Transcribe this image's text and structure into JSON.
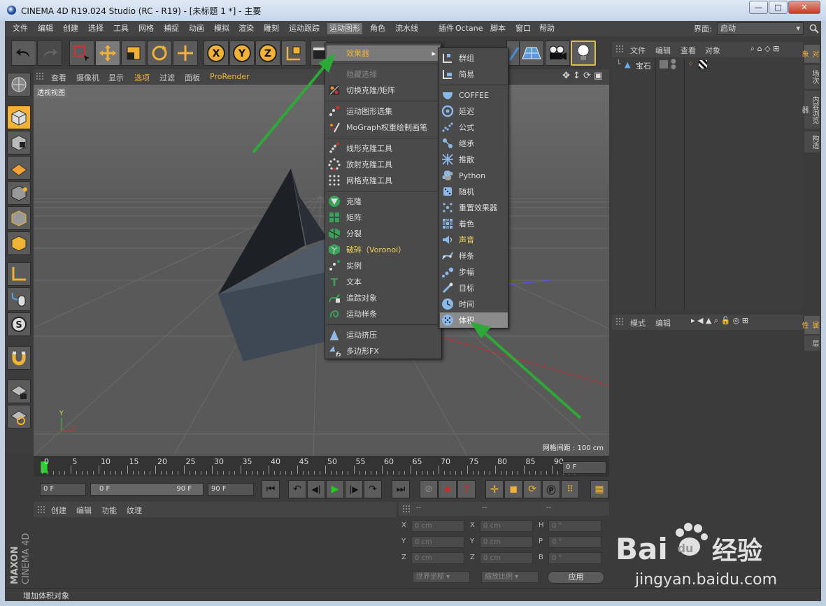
{
  "window": {
    "title": "CINEMA 4D R19.024 Studio (RC - R19) - [未标题 1 *] - 主要",
    "minimize": "—",
    "maximize": "□",
    "close": "✕"
  },
  "menubar": {
    "items": [
      "文件",
      "编辑",
      "创建",
      "选择",
      "工具",
      "网格",
      "捕捉",
      "动画",
      "模拟",
      "渲染",
      "雕刻",
      "运动跟踪",
      "运动图形",
      "角色",
      "流水线",
      "插件",
      "Octane",
      "脚本",
      "窗口",
      "帮助"
    ],
    "active": "运动图形",
    "layout_label": "界面:",
    "layout_value": "启动"
  },
  "viewport": {
    "menu": [
      "查看",
      "摄像机",
      "显示",
      "选项",
      "过滤",
      "面板",
      "ProRender"
    ],
    "label": "透视视图",
    "grid_spacing": "网格间距 : 100 cm"
  },
  "timeline": {
    "ticks": [
      "0",
      "5",
      "10",
      "15",
      "20",
      "25",
      "30",
      "35",
      "40",
      "45",
      "50",
      "55",
      "60",
      "65",
      "70",
      "75",
      "80",
      "85",
      "90"
    ],
    "current_frame": "0 F"
  },
  "playback": {
    "start": "0 F",
    "range_start": "0 F",
    "range_end": "90 F",
    "end": "90 F"
  },
  "material": {
    "menu": [
      "创建",
      "编辑",
      "功能",
      "纹理"
    ]
  },
  "coords": {
    "header": [
      "--",
      "--",
      "--"
    ],
    "rows": [
      {
        "a": "X",
        "av": "0 cm",
        "b": "X",
        "bv": "0 cm",
        "c": "H",
        "cv": "0 °"
      },
      {
        "a": "Y",
        "av": "0 cm",
        "b": "Y",
        "bv": "0 cm",
        "c": "P",
        "cv": "0 °"
      },
      {
        "a": "Z",
        "av": "0 cm",
        "b": "Z",
        "bv": "0 cm",
        "c": "B",
        "cv": "0 °"
      }
    ],
    "world": "世界坐标",
    "scale": "缩放比例",
    "apply": "应用"
  },
  "status": "增加体积对象",
  "objects_panel": {
    "menu": [
      "文件",
      "编辑",
      "查看",
      "对象"
    ],
    "object_name": "宝石"
  },
  "attributes_panel": {
    "menu": [
      "模式",
      "编辑"
    ]
  },
  "right_tabs": [
    "对象",
    "场次",
    "内容浏览器",
    "构造",
    "属性",
    "层"
  ],
  "main_menu": {
    "items": [
      {
        "label": "效果器",
        "icon": "none-icon",
        "state": "highlight",
        "submenu": true
      },
      {
        "sep": true
      },
      {
        "label": "隐藏选择",
        "icon": "none-icon",
        "state": "disabled"
      },
      {
        "label": "切换克隆/矩阵",
        "icon": "toggle-clone-icon",
        "state": "normal"
      },
      {
        "sep": true
      },
      {
        "label": "运动图形选集",
        "icon": "mograph-selection-icon",
        "state": "normal"
      },
      {
        "label": "MoGraph权重绘制画笔",
        "icon": "weight-brush-icon",
        "state": "normal"
      },
      {
        "sep": true
      },
      {
        "label": "线形克隆工具",
        "icon": "linear-clone-icon",
        "state": "normal"
      },
      {
        "label": "放射克隆工具",
        "icon": "radial-clone-icon",
        "state": "normal"
      },
      {
        "label": "网格克隆工具",
        "icon": "grid-clone-icon",
        "state": "normal"
      },
      {
        "sep": true
      },
      {
        "label": "克隆",
        "icon": "cloner-icon",
        "state": "normal"
      },
      {
        "label": "矩阵",
        "icon": "matrix-icon",
        "state": "normal"
      },
      {
        "label": "分裂",
        "icon": "fracture-icon",
        "state": "normal"
      },
      {
        "label": "破碎（Voronoi）",
        "icon": "voronoi-icon",
        "state": "yellow"
      },
      {
        "label": "实例",
        "icon": "instance-icon",
        "state": "normal"
      },
      {
        "label": "文本",
        "icon": "text-icon",
        "state": "normal"
      },
      {
        "label": "追踪对象",
        "icon": "tracer-icon",
        "state": "normal"
      },
      {
        "label": "运动样条",
        "icon": "mospline-icon",
        "state": "normal"
      },
      {
        "sep": true
      },
      {
        "label": "运动挤压",
        "icon": "moextrude-icon",
        "state": "normal"
      },
      {
        "label": "多边形FX",
        "icon": "polyfx-icon",
        "state": "normal"
      }
    ]
  },
  "effector_menu": {
    "items": [
      {
        "label": "群组",
        "icon": "group-effector-icon",
        "state": "normal"
      },
      {
        "label": "简易",
        "icon": "plain-effector-icon",
        "state": "normal"
      },
      {
        "sep": true
      },
      {
        "label": "COFFEE",
        "icon": "coffee-effector-icon",
        "state": "normal"
      },
      {
        "label": "延迟",
        "icon": "delay-effector-icon",
        "state": "normal"
      },
      {
        "label": "公式",
        "icon": "formula-effector-icon",
        "state": "normal"
      },
      {
        "label": "继承",
        "icon": "inheritance-effector-icon",
        "state": "normal"
      },
      {
        "label": "推散",
        "icon": "push-apart-effector-icon",
        "state": "normal"
      },
      {
        "label": "Python",
        "icon": "python-effector-icon",
        "state": "normal"
      },
      {
        "label": "随机",
        "icon": "random-effector-icon",
        "state": "normal"
      },
      {
        "label": "重置效果器",
        "icon": "reeffector-icon",
        "state": "normal"
      },
      {
        "label": "着色",
        "icon": "shader-effector-icon",
        "state": "normal"
      },
      {
        "label": "声音",
        "icon": "sound-effector-icon",
        "state": "yellow"
      },
      {
        "label": "样条",
        "icon": "spline-effector-icon",
        "state": "normal"
      },
      {
        "label": "步幅",
        "icon": "step-effector-icon",
        "state": "normal"
      },
      {
        "label": "目标",
        "icon": "target-effector-icon",
        "state": "normal"
      },
      {
        "label": "时间",
        "icon": "time-effector-icon",
        "state": "normal"
      },
      {
        "label": "体积",
        "icon": "volume-effector-icon",
        "state": "selected"
      }
    ]
  },
  "colors": {
    "accent": "#f2b233",
    "arrow": "#2ea836",
    "panel": "#3b3b3b"
  },
  "watermark": {
    "brand_left": "Bai",
    "brand_right": "经验",
    "url": "jingyan.baidu.com"
  }
}
